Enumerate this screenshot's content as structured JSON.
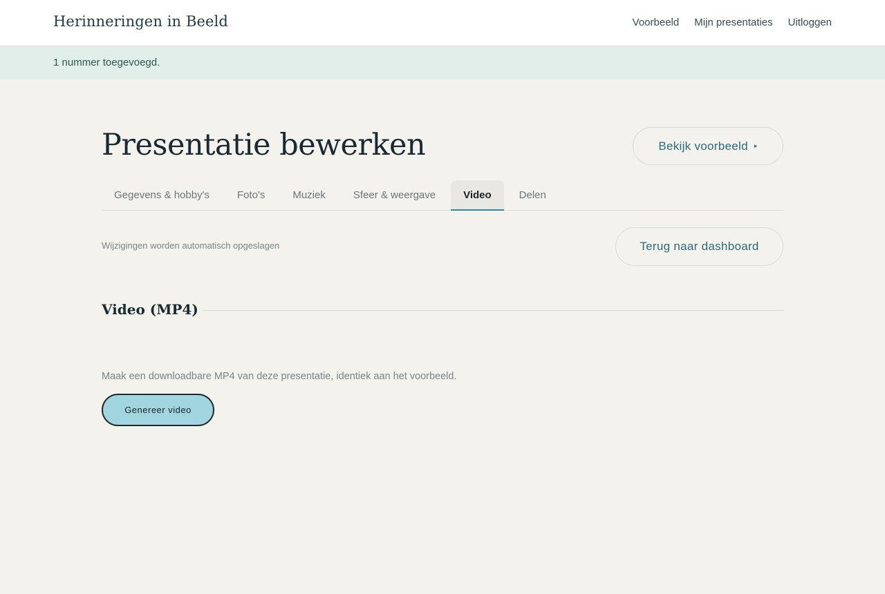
{
  "header": {
    "brand": "Herinneringen in Beeld",
    "nav": {
      "preview": "Voorbeeld",
      "presentations": "Mijn presentaties",
      "logout": "Uitloggen"
    }
  },
  "notice": {
    "text": "1 nummer toegevoegd."
  },
  "main": {
    "title": "Presentatie bewerken",
    "preview_button": "Bekijk voorbeeld",
    "preview_button_icon": "▸",
    "tabs": [
      {
        "label": "Gegevens & hobby's",
        "active": false
      },
      {
        "label": "Foto's",
        "active": false
      },
      {
        "label": "Muziek",
        "active": false
      },
      {
        "label": "Sfeer & weergave",
        "active": false
      },
      {
        "label": "Video",
        "active": true
      },
      {
        "label": "Delen",
        "active": false
      }
    ],
    "autosave": "Wijzigingen worden automatisch opgeslagen",
    "dashboard_button": "Terug naar dashboard"
  },
  "video_section": {
    "title": "Video (MP4)",
    "description": "Maak een downloadbare MP4 van deze presentatie, identiek aan het voorbeeld.",
    "generate_button": "Genereer video"
  },
  "colors": {
    "background": "#f4f2ec",
    "accent": "#2e8b9a",
    "button_fill": "#a1d5e0",
    "notice_bg": "#e2eee9"
  }
}
